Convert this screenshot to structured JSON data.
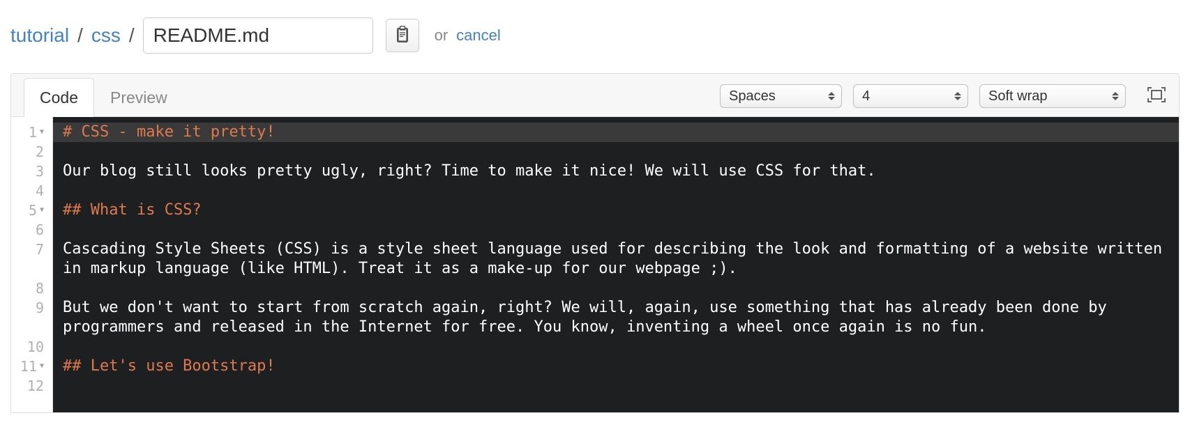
{
  "breadcrumb": {
    "root": "tutorial",
    "sub": "css",
    "sep": "/",
    "filename": "README.md"
  },
  "actions": {
    "or": "or",
    "cancel": "cancel"
  },
  "tabs": {
    "code": "Code",
    "preview": "Preview"
  },
  "toolbar": {
    "indent_mode": "Spaces",
    "indent_width": "4",
    "wrap_mode": "Soft wrap"
  },
  "editor": {
    "lines": [
      {
        "n": "1",
        "fold": true,
        "type": "heading",
        "text": "# CSS - make it pretty!",
        "active": true
      },
      {
        "n": "2",
        "fold": false,
        "type": "blank",
        "text": ""
      },
      {
        "n": "3",
        "fold": false,
        "type": "text",
        "text": "Our blog still looks pretty ugly, right? Time to make it nice! We will use CSS for that."
      },
      {
        "n": "4",
        "fold": false,
        "type": "blank",
        "text": ""
      },
      {
        "n": "5",
        "fold": true,
        "type": "heading",
        "text": "## What is CSS?"
      },
      {
        "n": "6",
        "fold": false,
        "type": "blank",
        "text": ""
      },
      {
        "n": "7",
        "fold": false,
        "type": "text",
        "text": "Cascading Style Sheets (CSS) is a style sheet language used for describing the look and formatting of a website written in markup language (like HTML). Treat it as a make-up for our webpage ;)."
      },
      {
        "n": "8",
        "fold": false,
        "type": "blank",
        "text": ""
      },
      {
        "n": "9",
        "fold": false,
        "type": "text",
        "text": "But we don't want to start from scratch again, right? We will, again, use something that has already been done by programmers and released in the Internet for free. You know, inventing a wheel once again is no fun."
      },
      {
        "n": "10",
        "fold": false,
        "type": "blank",
        "text": ""
      },
      {
        "n": "11",
        "fold": true,
        "type": "heading",
        "text": "## Let's use Bootstrap!"
      },
      {
        "n": "12",
        "fold": false,
        "type": "blank",
        "text": ""
      }
    ]
  }
}
